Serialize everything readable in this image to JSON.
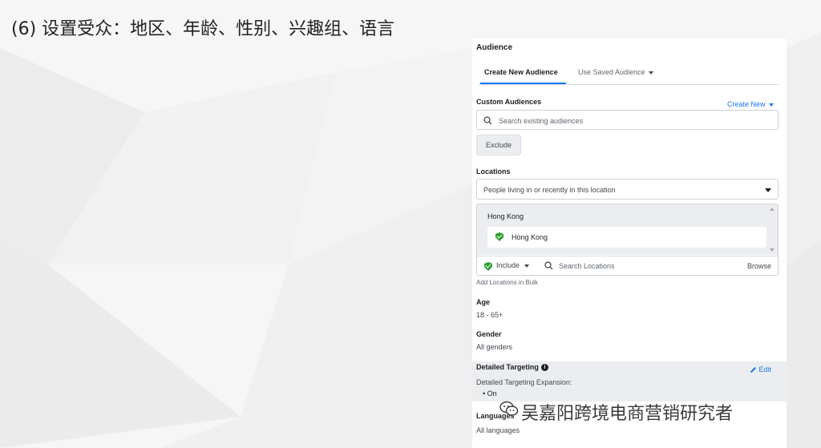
{
  "slide": {
    "title": "(6) 设置受众：地区、年龄、性别、兴趣组、语言"
  },
  "panel": {
    "title": "Audience",
    "tabs": [
      {
        "label": "Create New Audience",
        "active": true
      },
      {
        "label": "Use Saved Audience",
        "active": false
      }
    ],
    "custom_audiences": {
      "label": "Custom Audiences",
      "create_new": "Create New",
      "search_placeholder": "Search existing audiences",
      "exclude_button": "Exclude"
    },
    "locations": {
      "label": "Locations",
      "select_value": "People living in or recently in this location",
      "group_header": "Hong Kong",
      "items": [
        "Hong Kong"
      ],
      "include_label": "Include",
      "search_placeholder": "Search Locations",
      "browse": "Browse",
      "add_bulk": "Add Locations in Bulk"
    },
    "age": {
      "label": "Age",
      "value": "18 - 65+"
    },
    "gender": {
      "label": "Gender",
      "value": "All genders"
    },
    "detailed_targeting": {
      "label": "Detailed Targeting",
      "edit": "Edit",
      "expansion_label": "Detailed Targeting Expansion:",
      "expansion_value": "• On"
    },
    "languages": {
      "label": "Languages",
      "value": "All languages"
    }
  },
  "watermark": {
    "text": "吴嘉阳跨境电商营销研究者"
  },
  "colors": {
    "accent": "#1877f2",
    "green_shield": "#2fa02f",
    "panel_bg": "#ffffff",
    "band_bg": "#ebedf0"
  },
  "icons": [
    "search-icon",
    "shield-check-icon",
    "info-icon",
    "pencil-icon",
    "caret-down-icon",
    "wechat-icon"
  ]
}
